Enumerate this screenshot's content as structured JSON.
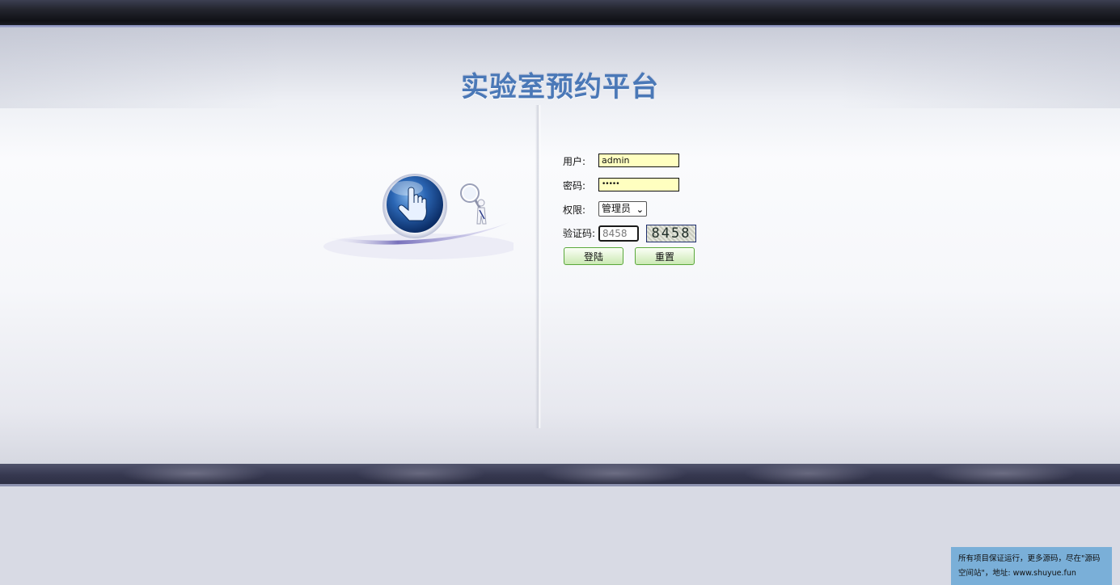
{
  "header": {
    "title": "实验室预约平台"
  },
  "login": {
    "username_label": "用户:",
    "username_value": "admin",
    "password_label": "密码:",
    "password_value": "•••••",
    "role_label": "权限:",
    "role_selected": "管理员",
    "captcha_label": "验证码:",
    "captcha_input_value": "8458",
    "captcha_image_text": "8458",
    "login_button": "登陆",
    "reset_button": "重置"
  },
  "notice": {
    "line1": "所有项目保证运行，更多源码，尽在\"源码",
    "line2": "空间站\"，地址: www.shuyue.fun"
  },
  "colors": {
    "title": "#4a78b7",
    "field_background": "#ffffc0",
    "button_border": "#5aa83b",
    "notice_background": "#7aafd8",
    "top_bar": "#1b1c25"
  },
  "icons": {
    "logo": "pointing-hand-globe-with-magnifier-figure",
    "role_dropdown": "chevron-down-icon"
  }
}
